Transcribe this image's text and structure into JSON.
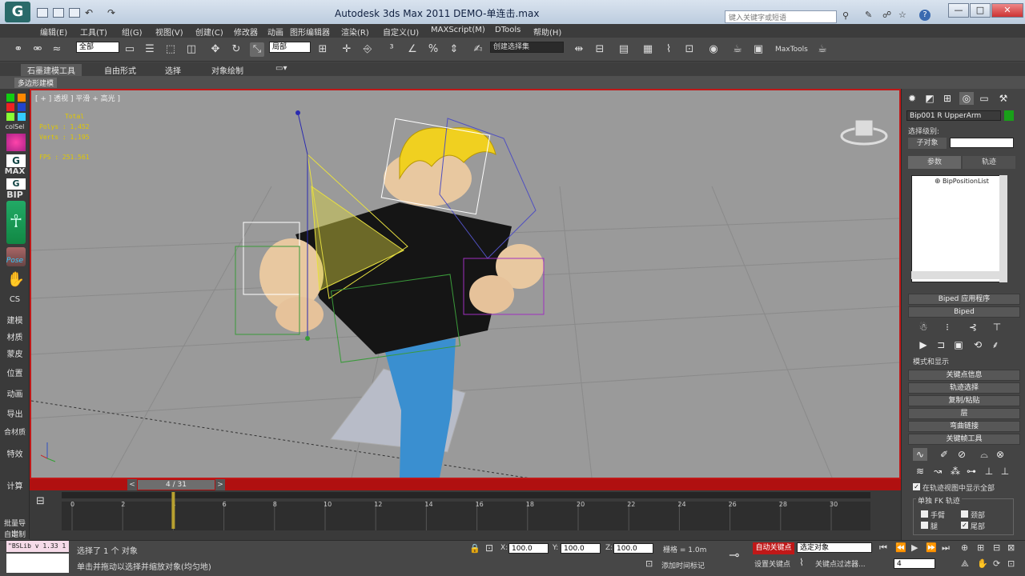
{
  "window": {
    "title": "Autodesk 3ds Max  2011     DEMO-单连击.max",
    "search_placeholder": "键入关键字或短语",
    "help_label": "?",
    "min": "—",
    "max": "□",
    "close": "✕"
  },
  "menus": [
    "编辑(E)",
    "工具(T)",
    "组(G)",
    "视图(V)",
    "创建(C)",
    "修改器",
    "动画",
    "图形编辑器",
    "渲染(R)",
    "自定义(U)",
    "MAXScript(M)",
    "DTools",
    "帮助(H)"
  ],
  "toolbar": {
    "filter_select": "全部",
    "coord_select": "局部",
    "named_sel": "创建选择集",
    "maxtools": "MaxTools"
  },
  "ribbon": {
    "tabs": [
      "石墨建模工具",
      "自由形式",
      "选择",
      "对象绘制"
    ],
    "sub_tab": "多边形建模"
  },
  "leftbar": {
    "labels": [
      "colSel",
      "MAX",
      "BIP",
      "Pose",
      "CS",
      "建模",
      "材质",
      "蒙皮",
      "位置",
      "动画",
      "导出",
      "合材质",
      "特效",
      "计算",
      "批量导出",
      "自定制"
    ]
  },
  "viewport": {
    "label": "[ + ] 透视 ] 平滑 + 高光 ]",
    "stats": {
      "total": "Total",
      "polys": "Polys : 1,452",
      "verts": "Verts : 1,195",
      "fps": "FPS :    251.561"
    }
  },
  "timeline": {
    "frame": "4 / 31",
    "ticks": [
      "0",
      "2",
      "4",
      "6",
      "8",
      "10",
      "12",
      "14",
      "16",
      "18",
      "20",
      "22",
      "24",
      "26",
      "28",
      "30"
    ],
    "current": 4
  },
  "status": {
    "selected": "选择了 1 个 对象",
    "hint": "单击并拖动以选择并缩放对象(均匀地)",
    "x": "100.0",
    "y": "100.0",
    "z": "100.0",
    "grid": "栅格 = 1.0m",
    "add_time_tag": "添加时间标记",
    "auto_key": "自动关键点",
    "set_key": "设置关键点",
    "sel_object": "选定对象",
    "key_filter": "关键点过滤器...",
    "frame_field": "4",
    "script_label": "\"BSLib v 1.33 1"
  },
  "cmdpanel": {
    "object_name": "Bip001 R UpperArm",
    "sel_level": "选择级别:",
    "subobject": "子对象",
    "tab_params": "参数",
    "tab_track": "轨迹",
    "tree_item": "BipPositionList",
    "rollouts": [
      "Biped 应用程序",
      "Biped",
      "模式和显示",
      "关键点信息",
      "轨迹选择",
      "复制/粘贴",
      "层",
      "弯曲链接",
      "关键帧工具"
    ],
    "show_all": "在轨迹视图中显示全部",
    "fk_track": "单独 FK 轨迹",
    "arm": "手臂",
    "neck": "颈部",
    "leg": "腿",
    "tail": "尾部"
  },
  "colors": {
    "accent_red": "#c01818",
    "yellow": "#e0c800"
  }
}
